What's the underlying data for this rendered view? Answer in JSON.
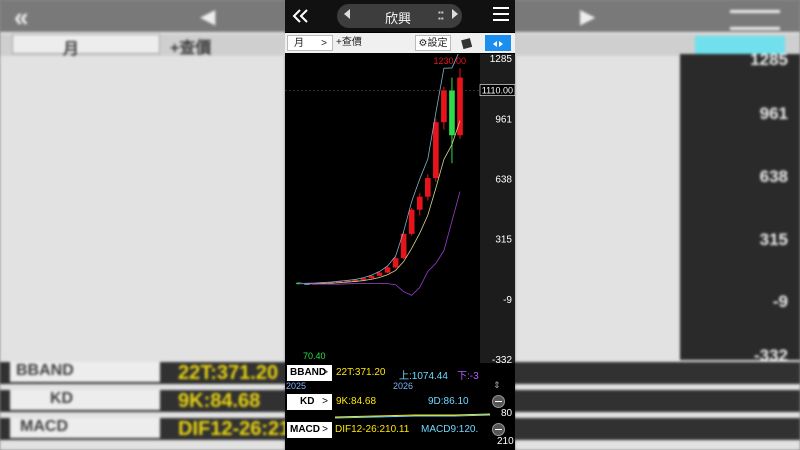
{
  "header": {
    "back_icon": "double-chevron-left-icon",
    "stock_name": "欣興",
    "prev_icon": "triangle-left-icon",
    "next_icon": "triangle-right-icon",
    "menu_icon": "hamburger-menu-icon"
  },
  "toolbar": {
    "period_label": "月",
    "period_chevron": ">",
    "query_label": "+查價",
    "settings_label": "⚙設定",
    "style_icon": "candle-style-icon",
    "expand_icon": "expand-arrows-icon"
  },
  "chart": {
    "y_ticks": [
      "1285",
      "961",
      "638",
      "315",
      "-9",
      "-332"
    ],
    "last_price": "1110.00",
    "high_label": "1230.00",
    "low_label": "70.40",
    "x_labels": [
      "2025",
      "2026"
    ],
    "colors": {
      "up": "#e8141c",
      "down": "#2ddc4a",
      "ma": "#d6d68a",
      "lower": "#9b3fd6",
      "middle": "#7fb0c8"
    },
    "candles": [
      {
        "o": 78,
        "h": 80,
        "l": 70,
        "c": 74
      },
      {
        "o": 74,
        "h": 76,
        "l": 72,
        "c": 72
      },
      {
        "o": 72,
        "h": 76,
        "l": 70,
        "c": 75
      },
      {
        "o": 75,
        "h": 80,
        "l": 74,
        "c": 78
      },
      {
        "o": 78,
        "h": 82,
        "l": 76,
        "c": 80
      },
      {
        "o": 80,
        "h": 85,
        "l": 79,
        "c": 84
      },
      {
        "o": 84,
        "h": 90,
        "l": 83,
        "c": 88
      },
      {
        "o": 88,
        "h": 96,
        "l": 86,
        "c": 93
      },
      {
        "o": 93,
        "h": 105,
        "l": 90,
        "c": 102
      },
      {
        "o": 102,
        "h": 118,
        "l": 100,
        "c": 115
      },
      {
        "o": 115,
        "h": 135,
        "l": 112,
        "c": 132
      },
      {
        "o": 132,
        "h": 165,
        "l": 130,
        "c": 160
      },
      {
        "o": 160,
        "h": 215,
        "l": 155,
        "c": 210
      },
      {
        "o": 210,
        "h": 350,
        "l": 205,
        "c": 340
      },
      {
        "o": 340,
        "h": 480,
        "l": 330,
        "c": 470
      },
      {
        "o": 470,
        "h": 560,
        "l": 440,
        "c": 540
      },
      {
        "o": 540,
        "h": 660,
        "l": 520,
        "c": 640
      },
      {
        "o": 640,
        "h": 960,
        "l": 620,
        "c": 940
      },
      {
        "o": 940,
        "h": 1130,
        "l": 900,
        "c": 1110
      },
      {
        "o": 1110,
        "h": 1180,
        "l": 720,
        "c": 870
      },
      {
        "o": 870,
        "h": 1230,
        "l": 850,
        "c": 1180
      }
    ],
    "upper_band": [],
    "middle_line": [],
    "lower_band": []
  },
  "indicators": {
    "bband": {
      "label": "BBAND",
      "chevron": ">",
      "v1": "22T:371.20",
      "v2": "上:1074.44",
      "v3": "下:-3"
    },
    "kd": {
      "label": "KD",
      "chevron": ">",
      "k": "9K:84.68",
      "d": "9D:86.10",
      "scale": "80"
    },
    "macd": {
      "label": "MACD",
      "chevron": ">",
      "dif": "DIF12-26:210.11",
      "macd": "MACD9:120.",
      "scale": "210"
    }
  }
}
